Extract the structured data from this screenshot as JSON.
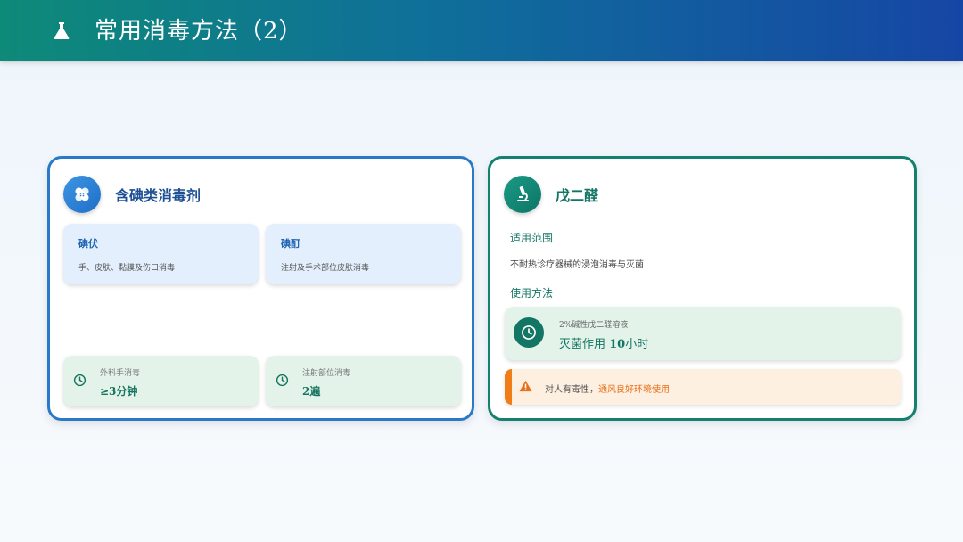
{
  "header": {
    "title": "常用消毒方法（2）",
    "icon": "flask-icon"
  },
  "colors": {
    "header_start": "#0e8a78",
    "header_end": "#1646a5",
    "blue": "#2a78c8",
    "green": "#14806f",
    "warning": "#f07d15"
  },
  "left_card": {
    "icon": "bandage-icon",
    "title": "含碘类消毒剂",
    "items": [
      {
        "title": "碘伏",
        "desc": "手、皮肤、黏膜及伤口消毒"
      },
      {
        "title": "碘酊",
        "desc": "注射及手术部位皮肤消毒"
      }
    ],
    "stats": [
      {
        "label": "外科手消毒",
        "value": "≥3分钟",
        "icon": "clock-icon"
      },
      {
        "label": "注射部位消毒",
        "value": "2遍",
        "icon": "clock-icon"
      }
    ]
  },
  "right_card": {
    "icon": "microscope-icon",
    "title": "戊二醛",
    "scope_label": "适用范围",
    "scope_text": "不耐热诊疗器械的浸泡消毒与灭菌",
    "method_label": "使用方法",
    "method": {
      "label": "2%碱性戊二醛溶液",
      "value_prefix": "灭菌作用 ",
      "value_bold": "10",
      "value_suffix": "小时",
      "icon": "clock-icon"
    },
    "warning": {
      "text": "对人有毒性，",
      "highlight": "通风良好环境使用",
      "icon": "warning-icon"
    }
  }
}
